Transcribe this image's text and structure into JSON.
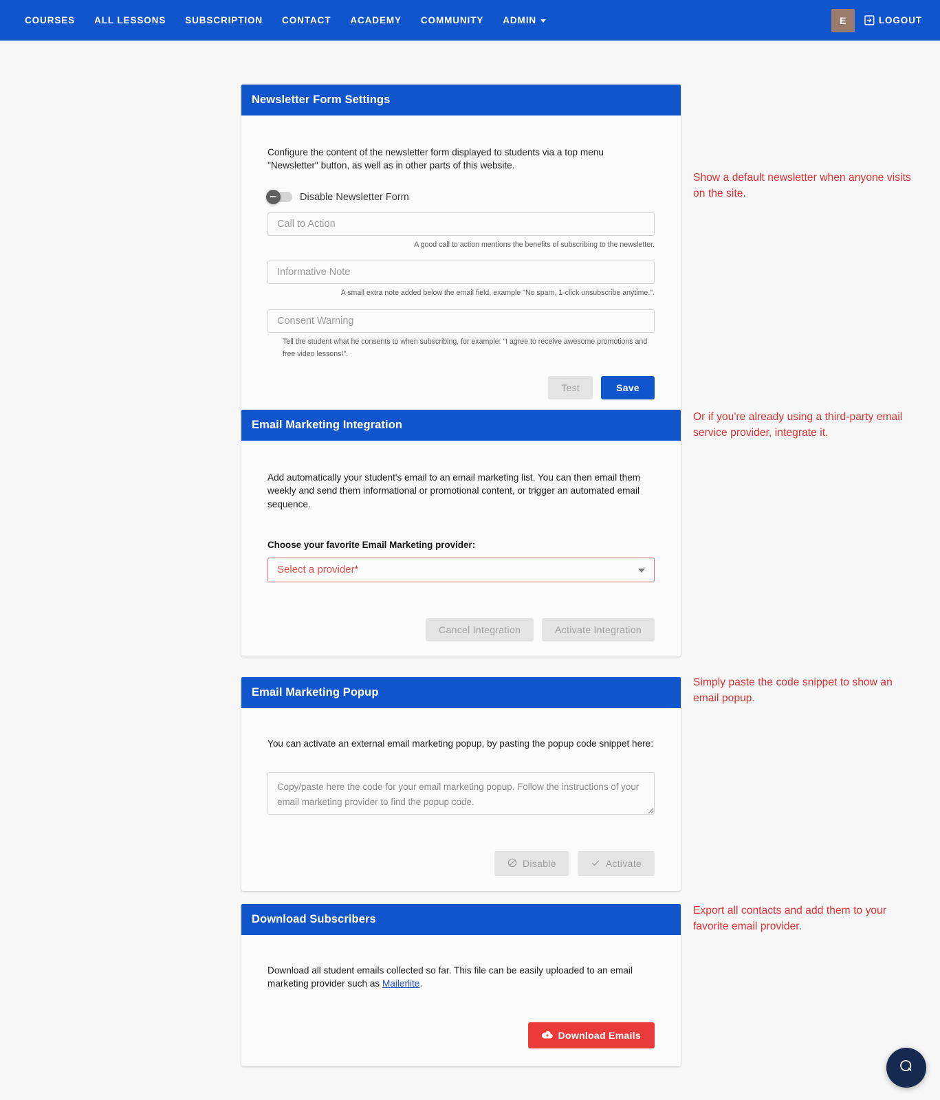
{
  "nav": {
    "items": [
      {
        "label": "COURSES",
        "caret": false
      },
      {
        "label": "ALL LESSONS",
        "caret": false
      },
      {
        "label": "SUBSCRIPTION",
        "caret": false
      },
      {
        "label": "CONTACT",
        "caret": false
      },
      {
        "label": "ACADEMY",
        "caret": false
      },
      {
        "label": "COMMUNITY",
        "caret": false
      },
      {
        "label": "ADMIN",
        "caret": true
      }
    ],
    "avatar_initial": "E",
    "logout_label": "LOGOUT",
    "bg_color": "#1155cc"
  },
  "cards": {
    "newsletter": {
      "title": "Newsletter Form Settings",
      "description": "Configure the content of the newsletter form displayed to students via a top menu \"Newsletter\" button, as well as in other parts of this website.",
      "toggle_label": "Disable Newsletter Form",
      "toggle_state": "off",
      "fields": [
        {
          "placeholder": "Call to Action",
          "value": "",
          "hint": "A good call to action mentions the benefits of subscribing to the newsletter."
        },
        {
          "placeholder": "Informative Note",
          "value": "",
          "hint": "A small extra note added below the email field, example \"No spam, 1-click unsubscribe anytime.\"."
        },
        {
          "placeholder": "Consent Warning",
          "value": "",
          "hint": "Tell the student what he consents to when subscribing, for example: \"I agree to receive awesome promotions and free video lessons!\"."
        }
      ],
      "test_label": "Test",
      "save_label": "Save"
    },
    "integration": {
      "title": "Email Marketing Integration",
      "description": "Add automatically your student's email to an email marketing list. You can then email them weekly and send them informational or promotional content, or trigger an automated email sequence.",
      "select_label": "Choose your favorite Email Marketing provider:",
      "select_value": "Select a provider*",
      "cancel_label": "Cancel Integration",
      "activate_label": "Activate Integration"
    },
    "popup": {
      "title": "Email Marketing Popup",
      "description": "You can activate an external email marketing popup, by pasting the popup code snippet here:",
      "textarea_placeholder": "Copy/paste here the code for your email marketing popup. Follow the instructions of your email marketing provider to find the popup code.",
      "textarea_value": "",
      "disable_label": "Disable",
      "activate_label": "Activate"
    },
    "download": {
      "title": "Download Subscribers",
      "description_before": "Download all student emails collected so far. This file can be easily uploaded to an email marketing provider such as ",
      "link_text": "Mailerlite",
      "description_after": ".",
      "download_label": "Download Emails"
    }
  },
  "notes": {
    "note1": "Show a default newsletter when anyone visits on the site.",
    "note2": "Or if you're already using a third-party email service provider, integrate it.",
    "note3": "Simply paste the code snippet to show an email popup.",
    "note4": "Export all contacts and add them to your favorite email provider.",
    "color": "#e03030"
  },
  "chat": {
    "icon": "chat-bubble-icon"
  }
}
